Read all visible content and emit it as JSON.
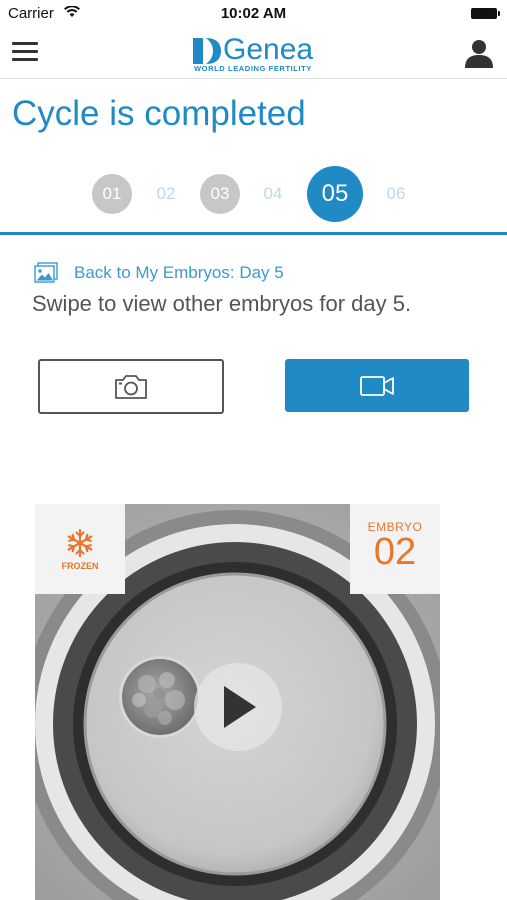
{
  "status_bar": {
    "carrier": "Carrier",
    "time": "10:02 AM"
  },
  "header": {
    "logo_word": "Genea",
    "logo_tagline": "WORLD LEADING FERTILITY"
  },
  "page": {
    "title": "Cycle is completed"
  },
  "steps": [
    {
      "label": "01",
      "state": "done"
    },
    {
      "label": "02",
      "state": "pending"
    },
    {
      "label": "03",
      "state": "done"
    },
    {
      "label": "04",
      "state": "pending"
    },
    {
      "label": "05",
      "state": "active"
    },
    {
      "label": "06",
      "state": "pending"
    }
  ],
  "back_link": {
    "label": "Back to My Embryos: Day 5",
    "icon": "gallery-icon"
  },
  "subtitle": "Swipe to view other embryos for day 5.",
  "buttons": {
    "photo_icon": "camera-icon",
    "video_icon": "video-camera-icon"
  },
  "embryo": {
    "frozen_label": "FROZEN",
    "frozen_icon": "snowflake-icon",
    "embryo_word": "EMBRYO",
    "embryo_number": "02"
  },
  "colors": {
    "brand_blue": "#1f8ac4",
    "accent_orange": "#e8762d",
    "step_done_gray": "#c7c7c7",
    "step_pending": "#bcd9ea"
  }
}
